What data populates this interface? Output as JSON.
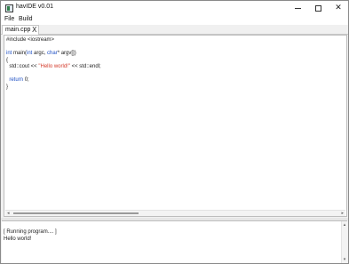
{
  "window": {
    "title": "havIDE v0.01",
    "minimize_glyph": "",
    "maximize_glyph": "",
    "close_glyph": "✕"
  },
  "menu": {
    "file": "File",
    "build": "Build"
  },
  "tab": {
    "label": "main.cpp",
    "close_glyph": "X"
  },
  "editor": {
    "code_lines": [
      [
        {
          "t": "#include <iostream>",
          "c": "plain"
        }
      ],
      [
        {
          "t": "",
          "c": "plain"
        }
      ],
      [
        {
          "t": "int",
          "c": "kw"
        },
        {
          "t": " main(",
          "c": "plain"
        },
        {
          "t": "int",
          "c": "kw"
        },
        {
          "t": " argc, ",
          "c": "plain"
        },
        {
          "t": "char",
          "c": "kw"
        },
        {
          "t": "* argv[])",
          "c": "plain"
        }
      ],
      [
        {
          "t": "{",
          "c": "plain"
        }
      ],
      [
        {
          "t": "  std::cout << ",
          "c": "plain"
        },
        {
          "t": "\"Hello world!\"",
          "c": "str"
        },
        {
          "t": " << std::endl;",
          "c": "plain"
        }
      ],
      [
        {
          "t": "",
          "c": "plain"
        }
      ],
      [
        {
          "t": "  ",
          "c": "plain"
        },
        {
          "t": "return",
          "c": "kw"
        },
        {
          "t": " 0;",
          "c": "plain"
        }
      ],
      [
        {
          "t": "}",
          "c": "plain"
        }
      ]
    ],
    "hscroll_left_glyph": "◂",
    "hscroll_right_glyph": "▸"
  },
  "console": {
    "lines": [
      "[ Running program.... ]",
      "Hello world!"
    ],
    "vscroll_up_glyph": "▴",
    "vscroll_down_glyph": "▾"
  },
  "colors": {
    "keyword": "#1d4fc4",
    "string": "#d43a2a",
    "text": "#222222"
  }
}
